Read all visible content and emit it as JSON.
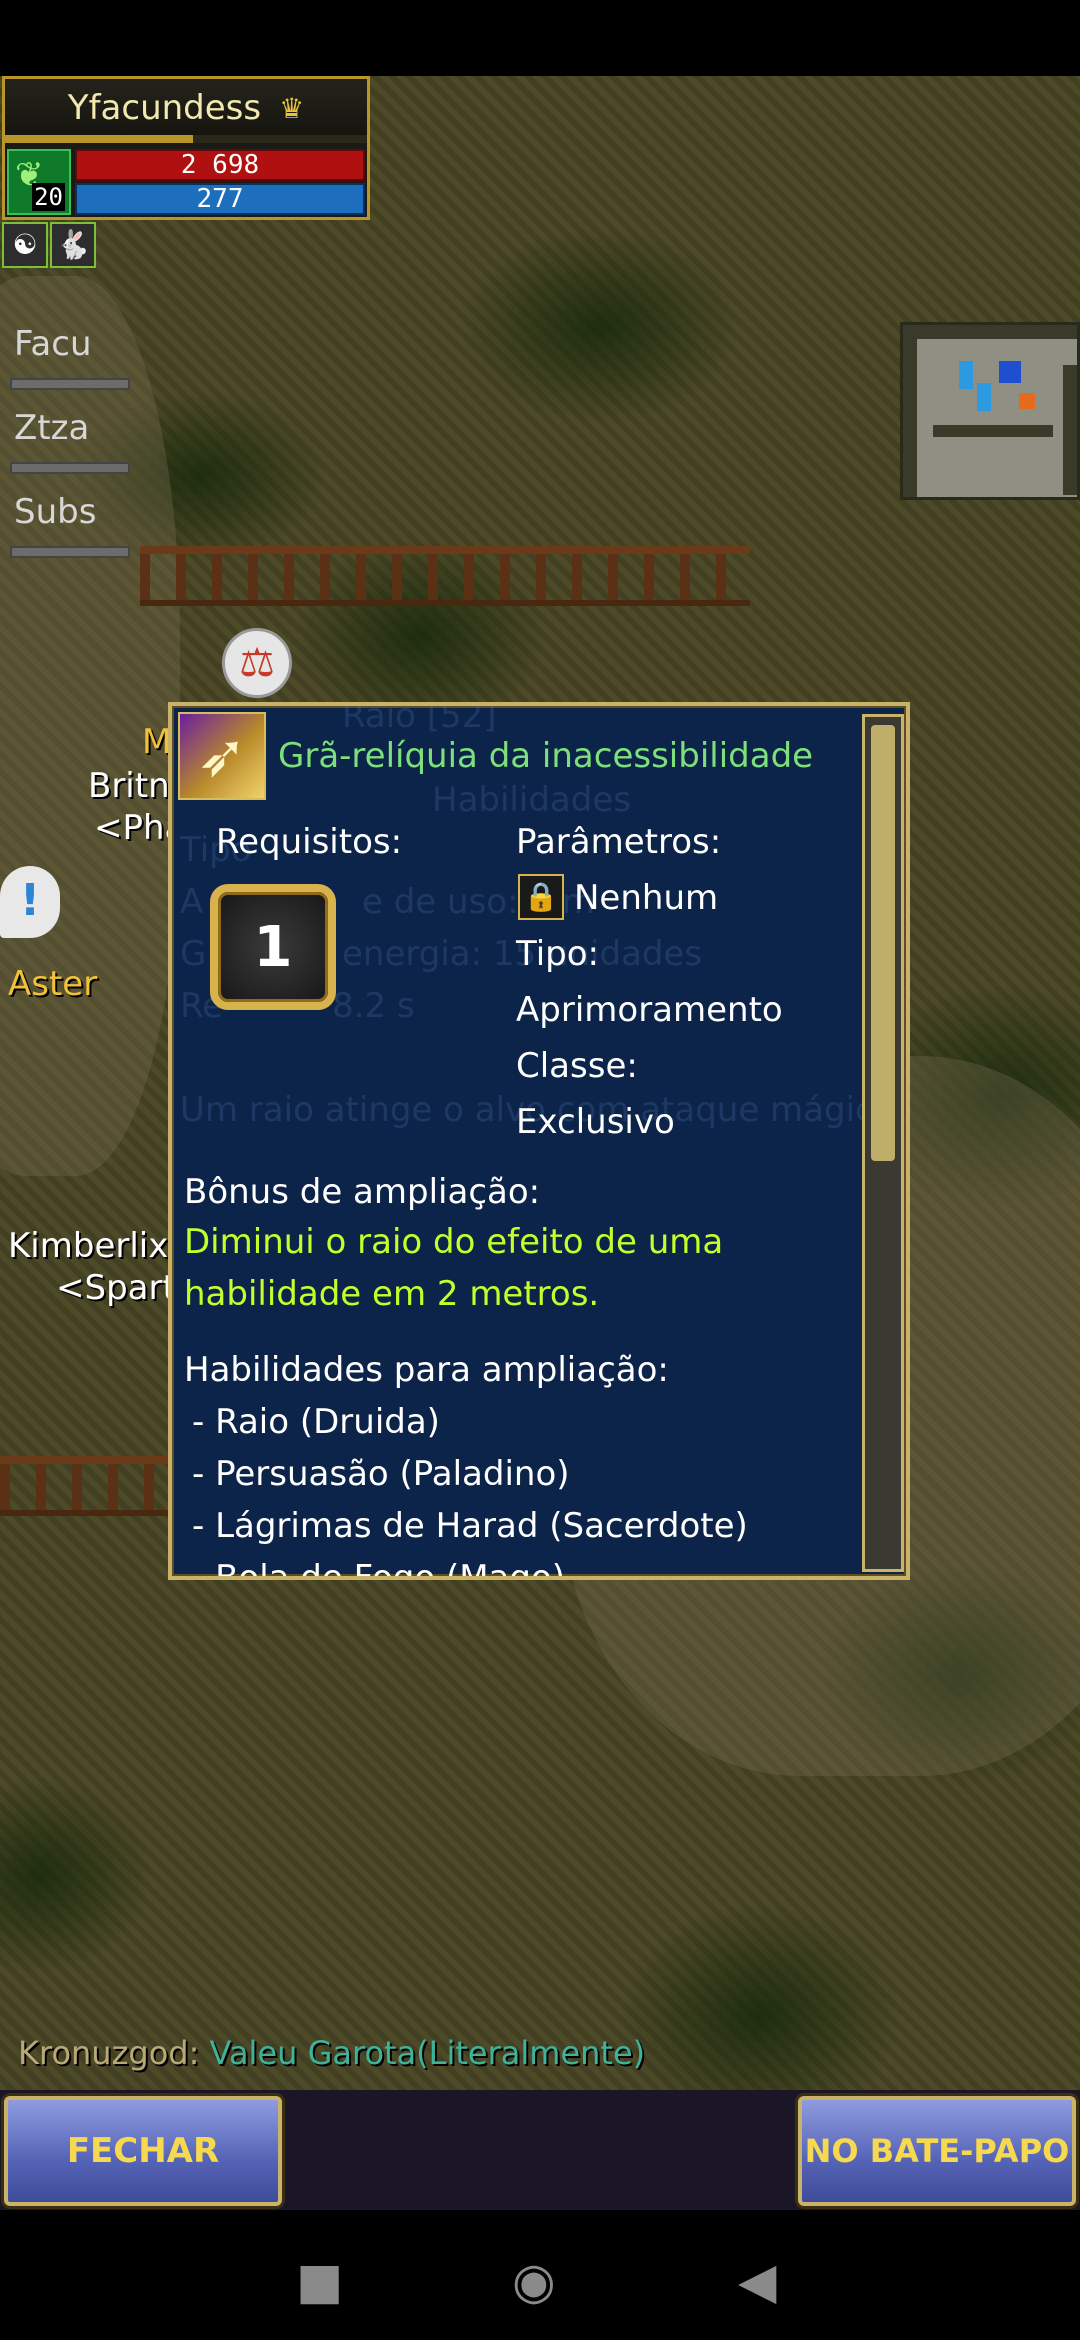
{
  "player": {
    "name": "Yfacundess",
    "level": "20",
    "hp": "2 698",
    "mp": "277",
    "xp_fraction": 0.52
  },
  "party": [
    "Facu",
    "Ztza",
    "Subs"
  ],
  "npcs": {
    "britn": "Britn",
    "pha": "<Pha",
    "aster": "Aster",
    "kimberlix": "Kimberlix",
    "spart": "<Spart",
    "m": "M"
  },
  "tooltip": {
    "title": "Grã-relíquia da inacessibilidade",
    "requirements_label": "Requisitos:",
    "requirement_level": "1",
    "parameters_label": "Parâmetros:",
    "lock_value": "Nenhum",
    "type_label": "Tipo:",
    "type_value": "Aprimoramento",
    "class_label": "Classe:",
    "class_value": "Exclusivo",
    "bonus_label": "Bônus de ampliação:",
    "bonus_line1": "Diminui o raio do efeito de uma",
    "bonus_line2": "habilidade em 2 metros.",
    "skills_label": "Habilidades para ampliação:",
    "skills": [
      " - Raio (Druida)",
      " - Persuasão (Paladino)",
      " - Lágrimas de Harad (Sacerdote)",
      " - Bola de Fogo (Mago)"
    ],
    "ghost": {
      "header": "Habilidades",
      "name": "Raio [52]",
      "tipo": "Tipo",
      "alcance_a": "A",
      "alcance_b": "e de uso: 7 m",
      "energia_a": "G",
      "energia_b": "energia: 15 unidades",
      "recarga_a": "Re",
      "recarga_b": "8.2 s",
      "desc": "Um raio atinge o alvo com ataque mágico"
    }
  },
  "chat": {
    "sender": "Kronuzgod:",
    "message": "Valeu Garota(Literalmente)"
  },
  "buttons": {
    "close": "FECHAR",
    "chat": "NO BATE-PAPO"
  }
}
